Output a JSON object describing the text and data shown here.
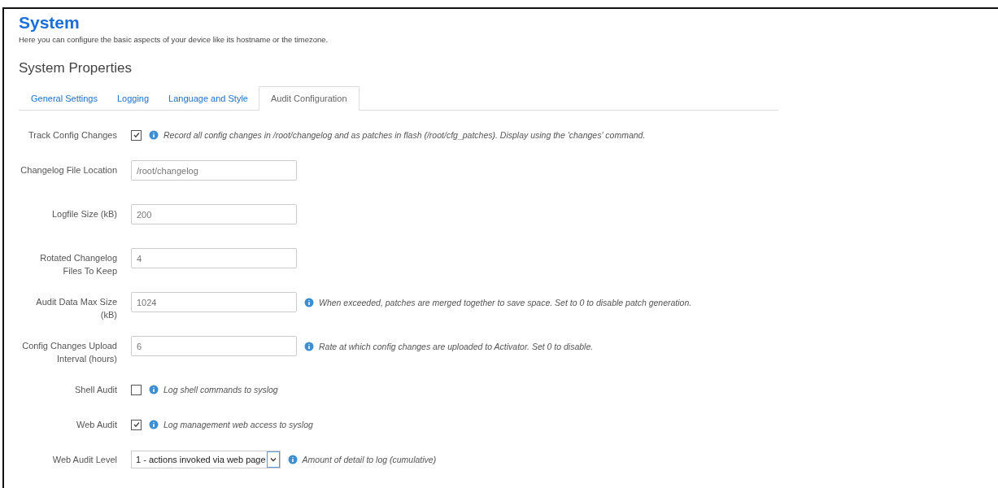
{
  "page": {
    "title": "System",
    "description": "Here you can configure the basic aspects of your device like its hostname or the timezone."
  },
  "section": {
    "title": "System Properties"
  },
  "tabs": [
    {
      "label": "General Settings",
      "selected": false
    },
    {
      "label": "Logging",
      "selected": false
    },
    {
      "label": "Language and Style",
      "selected": false
    },
    {
      "label": "Audit Configuration",
      "selected": true
    }
  ],
  "fields": [
    {
      "kind": "checkbox",
      "label": "Track Config Changes",
      "checked": true,
      "help": "Record all config changes in /root/changelog and as patches in flash (/root/cfg_patches). Display using the 'changes' command."
    },
    {
      "kind": "text",
      "label": "Changelog File Location",
      "value": "/root/changelog"
    },
    {
      "kind": "text",
      "label": "Logfile Size (kB)",
      "value": "200"
    },
    {
      "kind": "text",
      "label": "Rotated Changelog Files To Keep",
      "value": "4"
    },
    {
      "kind": "text",
      "label": "Audit Data Max Size (kB)",
      "value": "1024",
      "help": "When exceeded, patches are merged together to save space. Set to 0 to disable patch generation."
    },
    {
      "kind": "text",
      "label": "Config Changes Upload Interval (hours)",
      "value": "6",
      "help": "Rate at which config changes are uploaded to Activator. Set 0 to disable."
    },
    {
      "kind": "checkbox",
      "label": "Shell Audit",
      "checked": false,
      "help": "Log shell commands to syslog"
    },
    {
      "kind": "checkbox",
      "label": "Web Audit",
      "checked": true,
      "help": "Log management web access to syslog"
    },
    {
      "kind": "select",
      "label": "Web Audit Level",
      "value": "1 - actions invoked via web page",
      "help": "Amount of detail to log (cumulative)"
    }
  ]
}
